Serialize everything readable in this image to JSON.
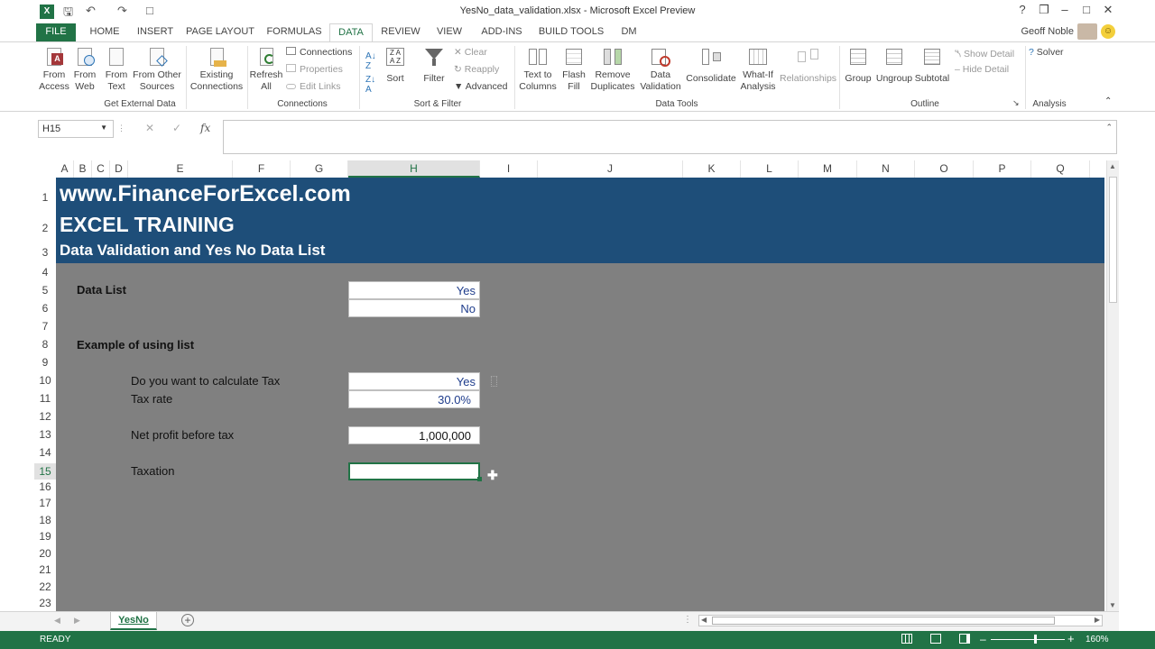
{
  "window": {
    "title": "YesNo_data_validation.xlsx - Microsoft Excel Preview",
    "user": "Geoff Noble"
  },
  "tabs": [
    "FILE",
    "HOME",
    "INSERT",
    "PAGE LAYOUT",
    "FORMULAS",
    "DATA",
    "REVIEW",
    "VIEW",
    "ADD-INS",
    "BUILD TOOLS",
    "DM"
  ],
  "ribbon": {
    "get_external": {
      "from_access": "From\nAccess",
      "from_web": "From\nWeb",
      "from_text": "From\nText",
      "from_other": "From Other\nSources",
      "label": "Get External Data"
    },
    "connections": {
      "existing": "Existing\nConnections",
      "refresh": "Refresh\nAll",
      "connections": "Connections",
      "properties": "Properties",
      "edit_links": "Edit Links",
      "label": "Connections"
    },
    "sort_filter": {
      "sort": "Sort",
      "filter": "Filter",
      "clear": "Clear",
      "reapply": "Reapply",
      "advanced": "Advanced",
      "label": "Sort & Filter"
    },
    "data_tools": {
      "text_to_columns": "Text to\nColumns",
      "flash_fill": "Flash\nFill",
      "remove_duplicates": "Remove\nDuplicates",
      "data_validation": "Data\nValidation",
      "consolidate": "Consolidate",
      "what_if": "What-If\nAnalysis",
      "relationships": "Relationships",
      "label": "Data Tools"
    },
    "outline": {
      "group": "Group",
      "ungroup": "Ungroup",
      "subtotal": "Subtotal",
      "show_detail": "Show Detail",
      "hide_detail": "Hide Detail",
      "label": "Outline"
    },
    "analysis": {
      "solver": "Solver",
      "label": "Analysis"
    }
  },
  "namebox": "H15",
  "columns": [
    "A",
    "B",
    "C",
    "D",
    "E",
    "F",
    "G",
    "H",
    "I",
    "J",
    "K",
    "L",
    "M",
    "N",
    "O",
    "P",
    "Q"
  ],
  "rows": [
    "1",
    "2",
    "3",
    "4",
    "5",
    "6",
    "7",
    "8",
    "9",
    "10",
    "11",
    "12",
    "13",
    "14",
    "15",
    "16",
    "17",
    "18",
    "19",
    "20",
    "21",
    "22",
    "23"
  ],
  "banner": {
    "line1": "www.FinanceForExcel.com",
    "line2": "EXCEL TRAINING",
    "line3": "Data Validation and Yes No Data List"
  },
  "sheet": {
    "data_list_label": "Data List",
    "list_yes": "Yes",
    "list_no": "No",
    "example_label": "Example of using list",
    "q_tax_label": "Do you want to calculate Tax",
    "q_tax_value": "Yes",
    "tax_rate_label": "Tax rate",
    "tax_rate_value": "30.0%",
    "npbt_label": "Net profit before tax",
    "npbt_value": "1,000,000",
    "taxation_label": "Taxation",
    "taxation_value": ""
  },
  "sheet_tabs": [
    "YesNo"
  ],
  "status": {
    "ready": "READY",
    "zoom": "160%"
  },
  "colors": {
    "excel_green": "#217346",
    "banner": "#1e4e79",
    "grid_grey": "#808080"
  }
}
